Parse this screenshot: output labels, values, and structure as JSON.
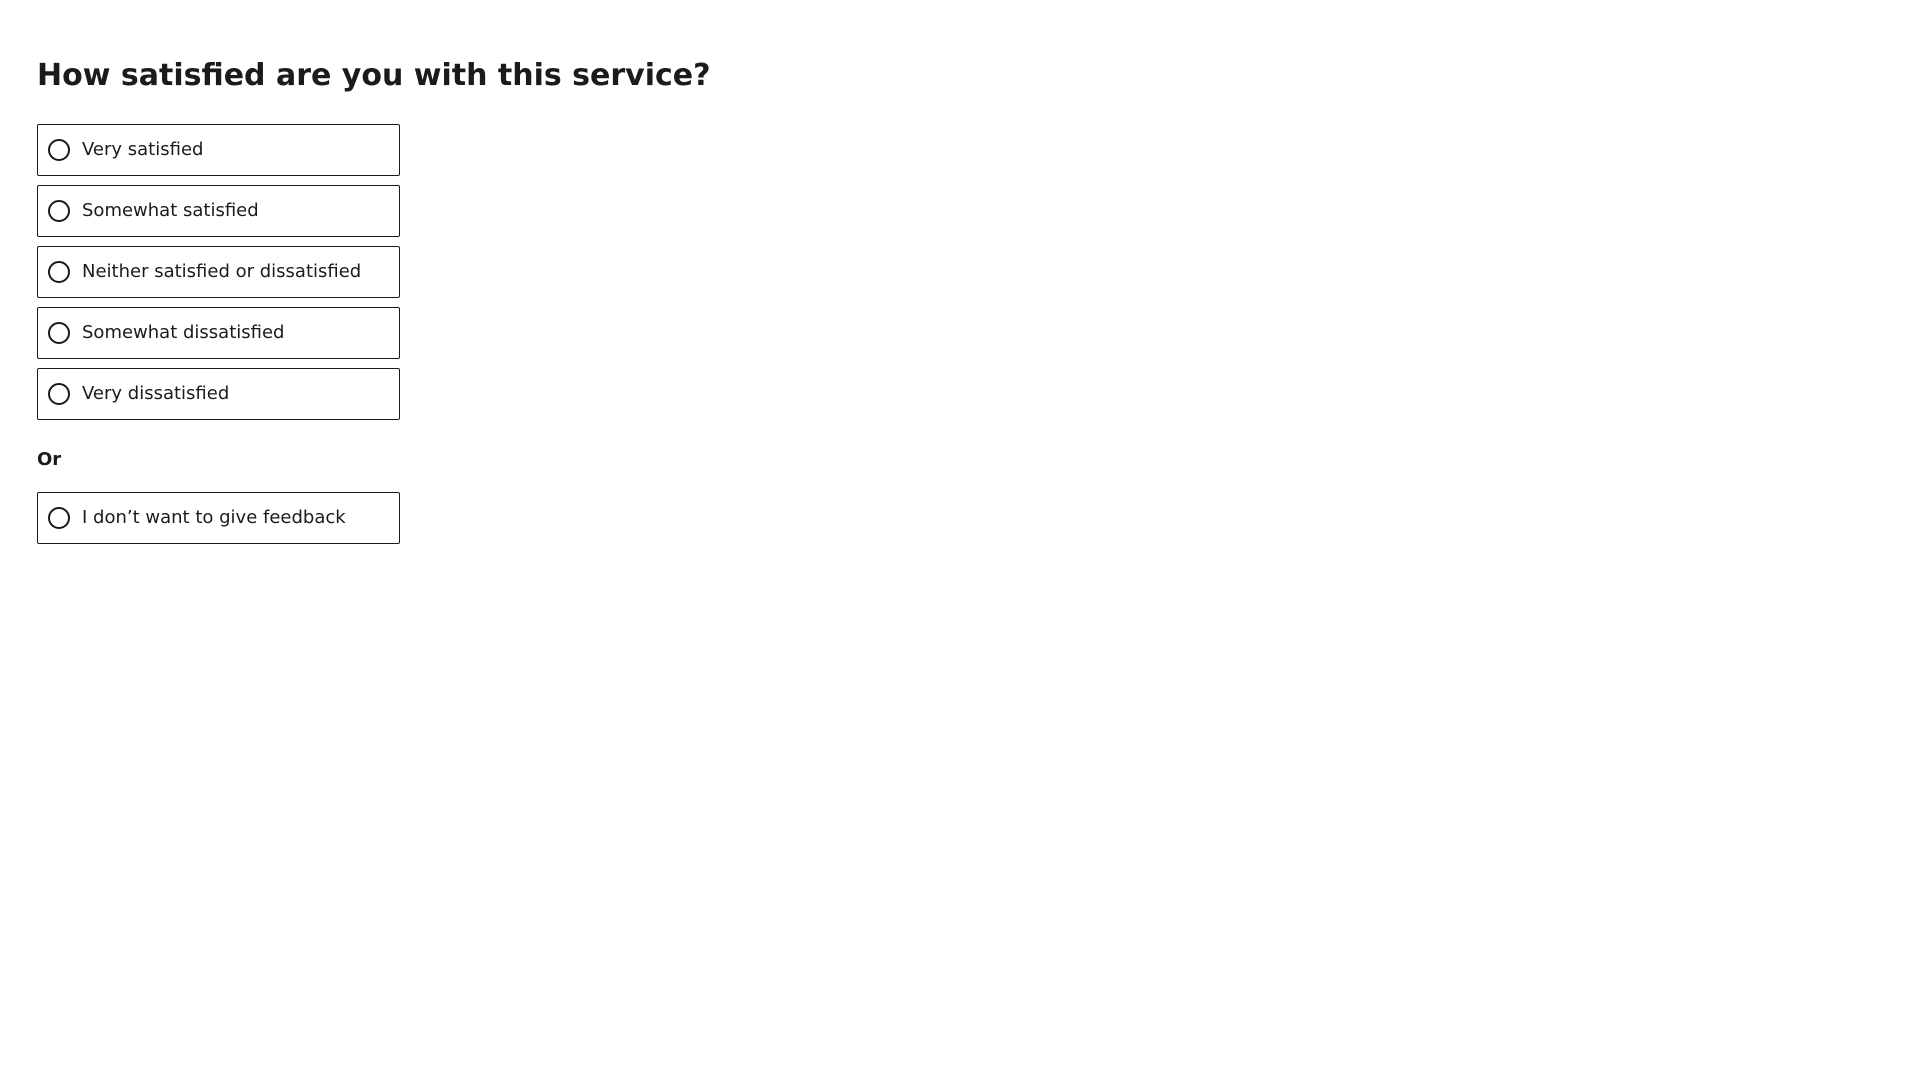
{
  "form": {
    "question": "How satisfied are you with this service?",
    "options": [
      {
        "label": "Very satisfied",
        "selected": false
      },
      {
        "label": "Somewhat satisfied",
        "selected": false
      },
      {
        "label": "Neither satisfied or dissatisfied",
        "selected": false
      },
      {
        "label": "Somewhat dissatisfied",
        "selected": false
      },
      {
        "label": "Very dissatisfied",
        "selected": false
      }
    ],
    "or_label": "Or",
    "opt_out": {
      "label": "I don’t want to give feedback",
      "selected": false
    }
  },
  "colors": {
    "text": "#1b1b1b",
    "border": "#1b1b1b",
    "background": "#ffffff"
  },
  "icons": {
    "radio": "radio-unchecked-icon"
  }
}
